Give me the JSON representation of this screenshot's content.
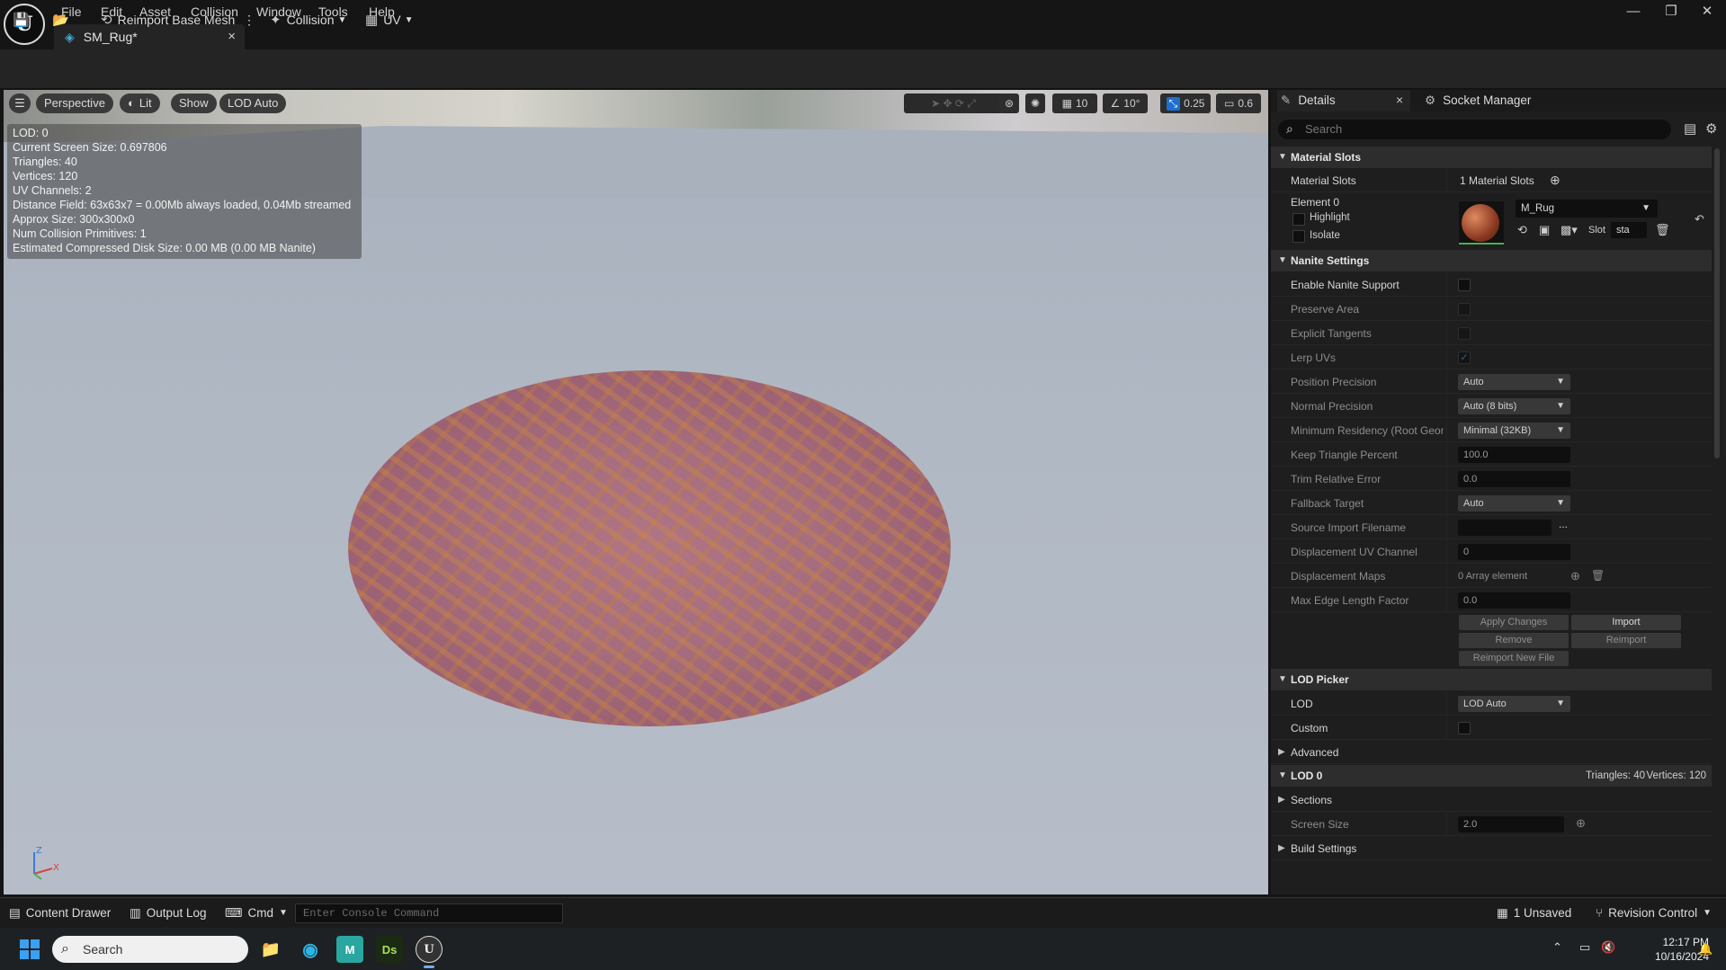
{
  "menu": [
    "File",
    "Edit",
    "Asset",
    "Collision",
    "Window",
    "Tools",
    "Help"
  ],
  "tab": {
    "title": "SM_Rug*",
    "close": "×"
  },
  "window_controls": [
    "—",
    "❐",
    "✕"
  ],
  "toolbar": {
    "reimport": "Reimport Base Mesh",
    "more": "⋮",
    "collision": "Collision",
    "uv": "UV"
  },
  "viewport": {
    "perspective": "Perspective",
    "lit": "Lit",
    "show": "Show",
    "lod": "LOD Auto",
    "grid": "10",
    "angle": "10°",
    "scale": "0.25",
    "camera_speed": "0.6",
    "stats": [
      "LOD:  0",
      "Current Screen Size:  0.697806",
      "Triangles:  40",
      "Vertices:  120",
      "UV Channels:  2",
      "Distance Field:  63x63x7 = 0.00Mb always loaded, 0.04Mb streamed",
      "Approx Size: 300x300x0",
      "Num Collision Primitives:  1",
      "Estimated Compressed Disk Size: 0.00 MB (0.00 MB Nanite)"
    ],
    "axes": {
      "x": "X",
      "z": "Z"
    }
  },
  "details": {
    "tab_details": "Details",
    "tab_close": "×",
    "tab_socket": "Socket Manager",
    "search_placeholder": "Search",
    "material_section": "Material Slots",
    "material_slots_label": "Material Slots",
    "material_slots_value": "1 Material Slots",
    "element0": "Element 0",
    "material_name": "M_Rug",
    "highlight": "Highlight",
    "isolate": "Isolate",
    "slot_label": "Slot",
    "slot_value": "sta",
    "nanite_section": "Nanite Settings",
    "nanite_rows": [
      {
        "label": "Enable Nanite Support"
      },
      {
        "label": "Preserve Area"
      },
      {
        "label": "Explicit Tangents"
      },
      {
        "label": "Lerp UVs"
      },
      {
        "label": "Position Precision",
        "value": "Auto"
      },
      {
        "label": "Normal Precision",
        "value": "Auto (8 bits)"
      },
      {
        "label": "Minimum Residency (Root Geome",
        "value": "Minimal (32KB)"
      },
      {
        "label": "Keep Triangle Percent",
        "value": "100.0"
      },
      {
        "label": "Trim Relative Error",
        "value": "0.0"
      },
      {
        "label": "Fallback Target",
        "value": "Auto"
      },
      {
        "label": "Source Import Filename",
        "value": "",
        "extra": "..."
      },
      {
        "label": "Displacement UV Channel",
        "value": "0"
      },
      {
        "label": "Displacement Maps",
        "value": "0 Array element"
      },
      {
        "label": "Max Edge Length Factor",
        "value": "0.0"
      }
    ],
    "buttons": {
      "apply": "Apply Changes",
      "import": "Import",
      "remove": "Remove",
      "reimport": "Reimport",
      "reimport_new": "Reimport New File"
    },
    "lod_picker_section": "LOD Picker",
    "lod_label": "LOD",
    "lod_value": "LOD Auto",
    "custom_label": "Custom",
    "advanced": "Advanced",
    "lod0_section": "LOD 0",
    "lod0_triangles": "Triangles: 40",
    "lod0_vertices": "Vertices: 120",
    "sections": "Sections",
    "screen_size_label": "Screen Size",
    "screen_size_value": "2.0",
    "build_settings": "Build Settings"
  },
  "statusbar": {
    "content_drawer": "Content Drawer",
    "output_log": "Output Log",
    "cmd": "Cmd",
    "console_placeholder": "Enter Console Command",
    "unsaved": "1 Unsaved",
    "revision": "Revision Control"
  },
  "taskbar": {
    "search": "Search",
    "time": "12:17 PM",
    "date": "10/16/2024",
    "ds": "Ds",
    "m": "M"
  }
}
